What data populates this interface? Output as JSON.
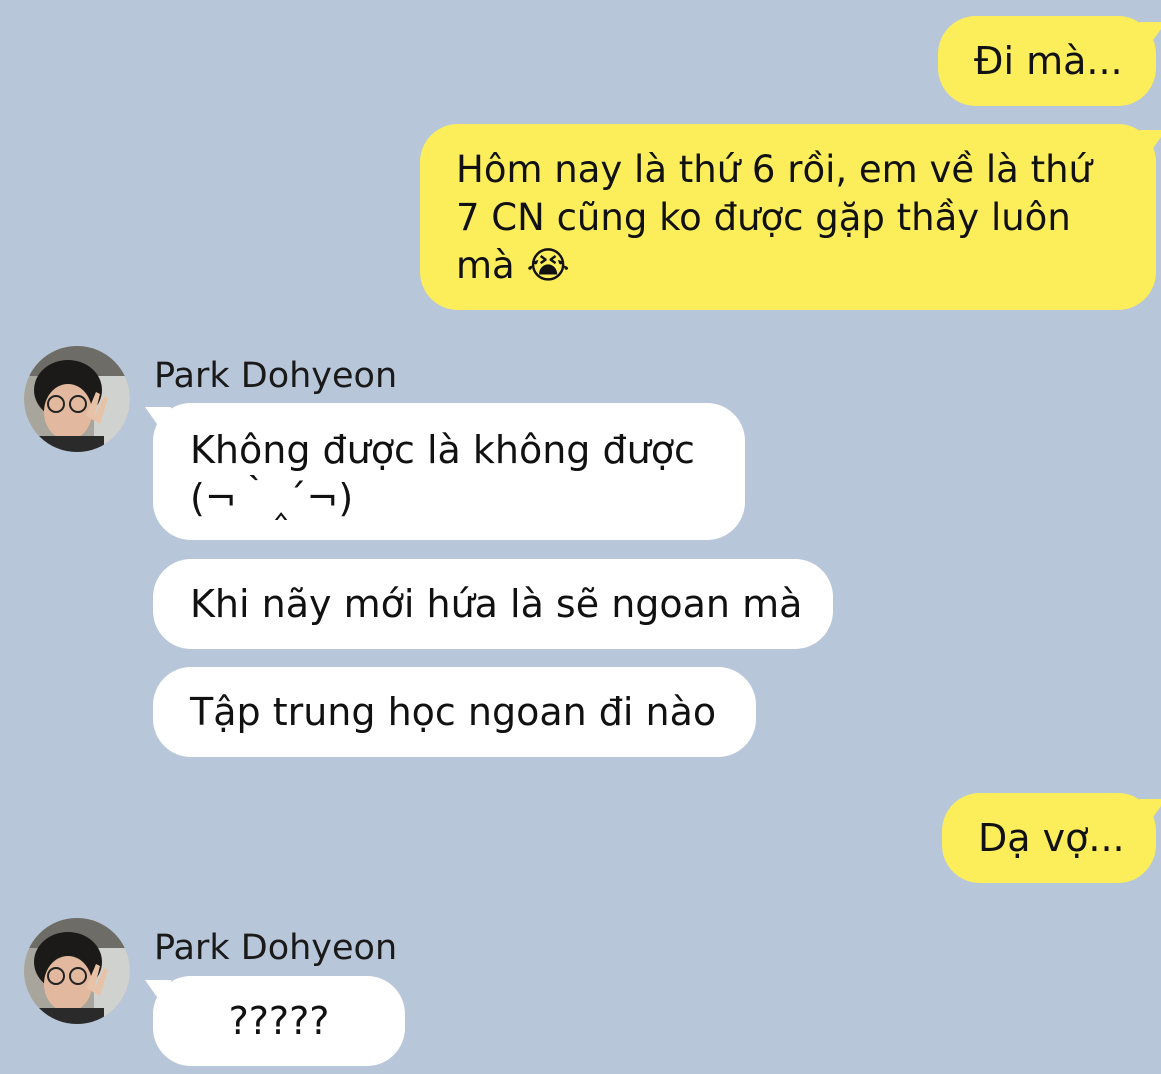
{
  "messages": [
    {
      "side": "out",
      "text": "Đi mà..."
    },
    {
      "side": "out",
      "text": "Hôm nay là thứ 6 rồi, em về là thứ 7 CN cũng ko được gặp thầy luôn mà 😭"
    },
    {
      "sender": "Park Dohyeon",
      "side": "in",
      "text": "Không được là không được (¬｀‸´¬)"
    },
    {
      "side": "in",
      "text": "Khi nãy mới hứa là sẽ ngoan mà"
    },
    {
      "side": "in",
      "text": "Tập trung học ngoan đi nào"
    },
    {
      "side": "out",
      "text": "Dạ vợ..."
    },
    {
      "sender": "Park Dohyeon",
      "side": "in",
      "text": "?????"
    }
  ],
  "colors": {
    "background": "#b8c6d9",
    "outgoing_bubble": "#fbee5a",
    "incoming_bubble": "#ffffff"
  },
  "icons": {
    "avatar": "avatar-photo",
    "emoji": "loudly-crying-face"
  }
}
